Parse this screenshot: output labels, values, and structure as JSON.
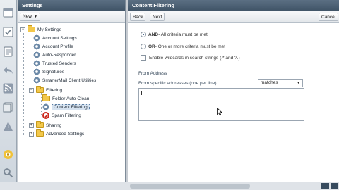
{
  "rail": {
    "icons": [
      "calendar-icon",
      "tasks-icon",
      "notes-icon",
      "reply-icon",
      "rss-icon",
      "documents-icon",
      "alert-icon",
      "settings-icon",
      "search-icon"
    ]
  },
  "settings": {
    "title": "Settings",
    "new_label": "New",
    "tree": {
      "root": "My Settings",
      "items": [
        "Account Settings",
        "Account Profile",
        "Auto-Responder",
        "Trusted Senders",
        "Signatures",
        "SmarterMail Client Utilities"
      ],
      "filtering": "Filtering",
      "filtering_items": [
        "Folder Auto-Clean",
        "Content Filtering",
        "Spam Filtering"
      ],
      "sharing": "Sharing",
      "advanced": "Advanced Settings"
    }
  },
  "content": {
    "title": "Content Filtering",
    "back_label": "Back",
    "next_label": "Next",
    "cancel_label": "Cancel",
    "and_bold": "AND",
    "and_rest": " - All criteria must be met",
    "or_bold": "OR",
    "or_rest": " - One or more criteria must be met",
    "wildcards": "Enable wildcards in search strings (.* and ?.)",
    "section_title": "From Address",
    "field_label": "From specific addresses (one per line)",
    "match_value": "matches"
  },
  "colors": {
    "header": "#4b5f73",
    "accent": "#f3c84b"
  }
}
